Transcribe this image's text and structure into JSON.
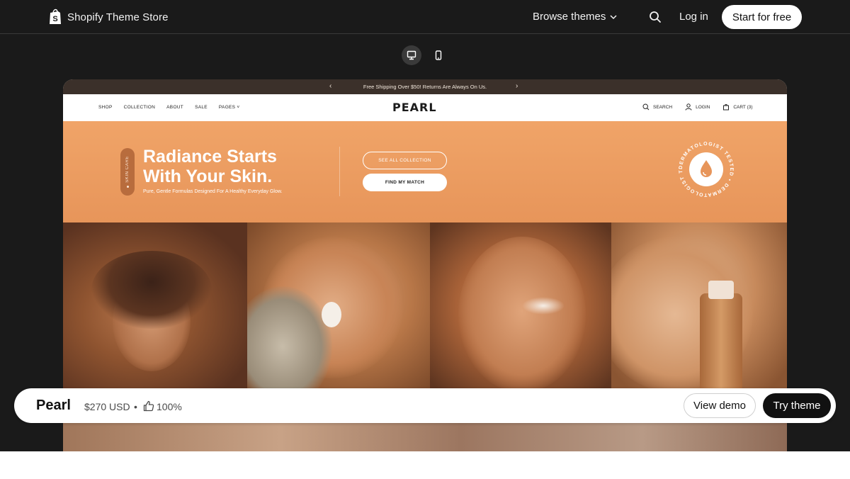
{
  "header": {
    "brand": "Shopify Theme Store",
    "browse": "Browse themes",
    "login": "Log in",
    "start": "Start for free"
  },
  "device_toggle": {
    "icons": [
      "desktop-icon",
      "mobile-icon"
    ],
    "selected": "desktop"
  },
  "preview": {
    "announcement": "Free Shipping Over $50! Returns Are Always On Us.",
    "nav_menu": [
      "SHOP",
      "COLLECTION",
      "ABOUT",
      "SALE",
      "PAGES"
    ],
    "logo": "PEARL",
    "actions": {
      "search": "SEARCH",
      "login": "LOGIN",
      "cart": "CART (3)"
    },
    "hero": {
      "badge": "SKIN CARE",
      "title_line1": "Radiance Starts",
      "title_line2": "With Your Skin.",
      "subtitle": "Pure, Gentle Formulas Designed For A Healthy Everyday Glow.",
      "btn_collection": "SEE ALL COLLECTION",
      "btn_match": "FIND MY MATCH",
      "seal_text": "DERMATOLOGIST TESTED • DERMATOLOGIST TESTED •"
    },
    "colors": {
      "hero": "#ec9d61",
      "announce": "#3b302a"
    }
  },
  "theme": {
    "name": "Pearl",
    "price": "$270 USD",
    "bullet": "•",
    "rating": "100%",
    "view_demo": "View demo",
    "try_theme": "Try theme"
  }
}
